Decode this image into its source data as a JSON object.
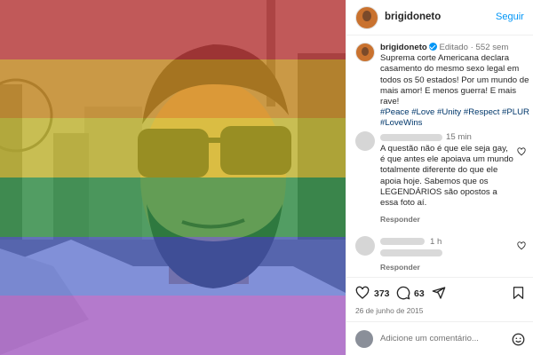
{
  "post": {
    "author": "brigidoneto",
    "follow_label": "Seguir",
    "edited_label": "Editado",
    "age": "552 sem",
    "caption": "Suprema corte Americana declara casamento do mesmo sexo legal em todos os 50 estados! Por um mundo de mais amor! E menos guerra! E mais rave!",
    "hashtags": "#Peace #Love #Unity #Respect #PLUR #LoveWins",
    "likes": "373",
    "comments_count": "63",
    "date": "26 de junho de 2015"
  },
  "comments": [
    {
      "time": "15 min",
      "text": "A questão não é que ele seja gay, é que antes ele apoiava um mundo totalmente diferente do que ele apoia hoje. Sabemos que os LEGENDÁRIOS são opostos a essa foto aí.",
      "reply_label": "Responder"
    },
    {
      "time": "1 h",
      "text": "",
      "reply_label": "Responder"
    }
  ],
  "add_comment": {
    "placeholder": "Adicione um comentário..."
  },
  "colors": {
    "rainbow": [
      "#e23a3a",
      "#f0a21b",
      "#f3e22a",
      "#2ea84a",
      "#4a63d6",
      "#9d3fc4"
    ],
    "accent": "#0095f6",
    "link": "#00376b"
  },
  "icons": [
    "verified-badge-icon",
    "heart-icon",
    "comment-icon",
    "share-icon",
    "bookmark-icon",
    "emoji-icon"
  ]
}
